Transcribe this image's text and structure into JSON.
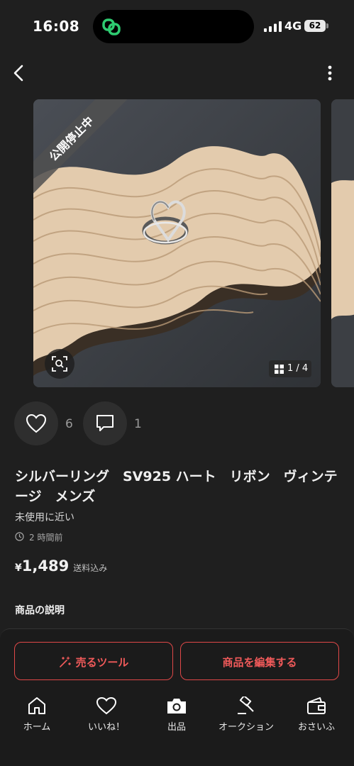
{
  "status_bar": {
    "time": "16:08",
    "network": "4G",
    "battery": "62"
  },
  "gallery": {
    "overlay_label": "公開停止中",
    "counter": "1 / 4"
  },
  "actions": {
    "like_count": "6",
    "comment_count": "1"
  },
  "item": {
    "title": "シルバーリング　SV925 ハート　リボン　ヴィンテージ　メンズ",
    "condition": "未使用に近い",
    "posted": "2 時間前",
    "currency": "¥",
    "price": "1,489",
    "shipping": "送料込み",
    "description_heading": "商品の説明"
  },
  "buttons": {
    "sell_tools": "売るツール",
    "edit_item": "商品を編集する"
  },
  "tabs": [
    {
      "label": "ホーム",
      "icon": "home-icon"
    },
    {
      "label": "いいね！",
      "icon": "heart-icon"
    },
    {
      "label": "出品",
      "icon": "camera-icon"
    },
    {
      "label": "オークション",
      "icon": "gavel-icon"
    },
    {
      "label": "おさいふ",
      "icon": "wallet-icon"
    }
  ],
  "colors": {
    "background": "#1f1f1f",
    "accent": "#e04848",
    "island_icon": "#2ecc71"
  }
}
